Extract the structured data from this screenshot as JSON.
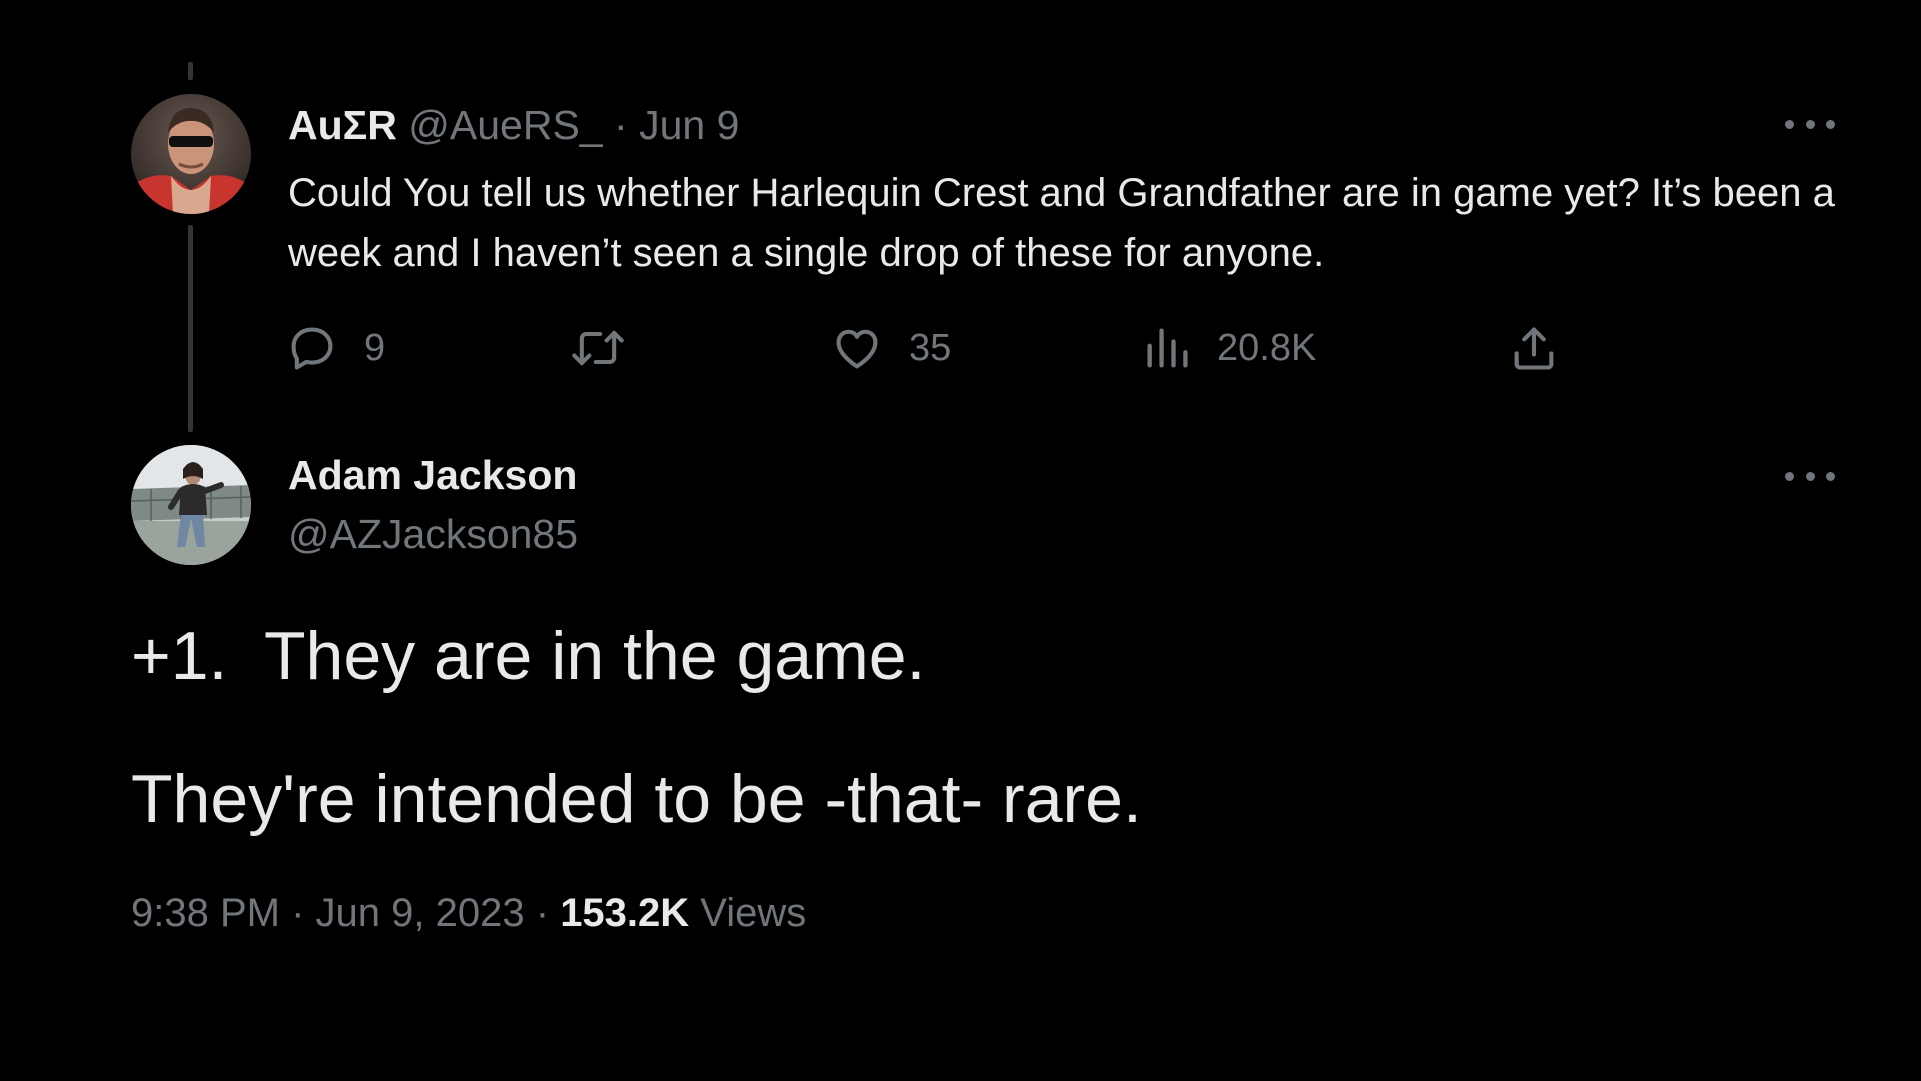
{
  "parent_tweet": {
    "display_name": "AuΣR",
    "handle": "@AueRS_",
    "separator": "·",
    "date": "Jun 9",
    "text": "Could You tell us whether Harlequin Crest and Grandfather are in game yet? It’s been a week and I haven’t seen a single drop of these for anyone.",
    "replies": "9",
    "likes": "35",
    "views": "20.8K"
  },
  "reply_tweet": {
    "display_name": "Adam Jackson",
    "handle": "@AZJackson85",
    "text_line1": "+1.  They are in the game.",
    "text_line2": "They're intended to be -that- rare.",
    "time": "9:38 PM",
    "sep1": "·",
    "date": "Jun 9, 2023",
    "sep2": "·",
    "views_count": "153.2K",
    "views_label": "Views"
  },
  "icons": {
    "reply": "reply-icon",
    "retweet": "retweet-icon",
    "like": "heart-icon",
    "views": "views-icon",
    "share": "share-icon",
    "more": "more-icon"
  },
  "colors": {
    "background": "#000000",
    "primary_text": "#e7e9ea",
    "secondary_text": "#71767b",
    "thread_line": "#333639"
  }
}
